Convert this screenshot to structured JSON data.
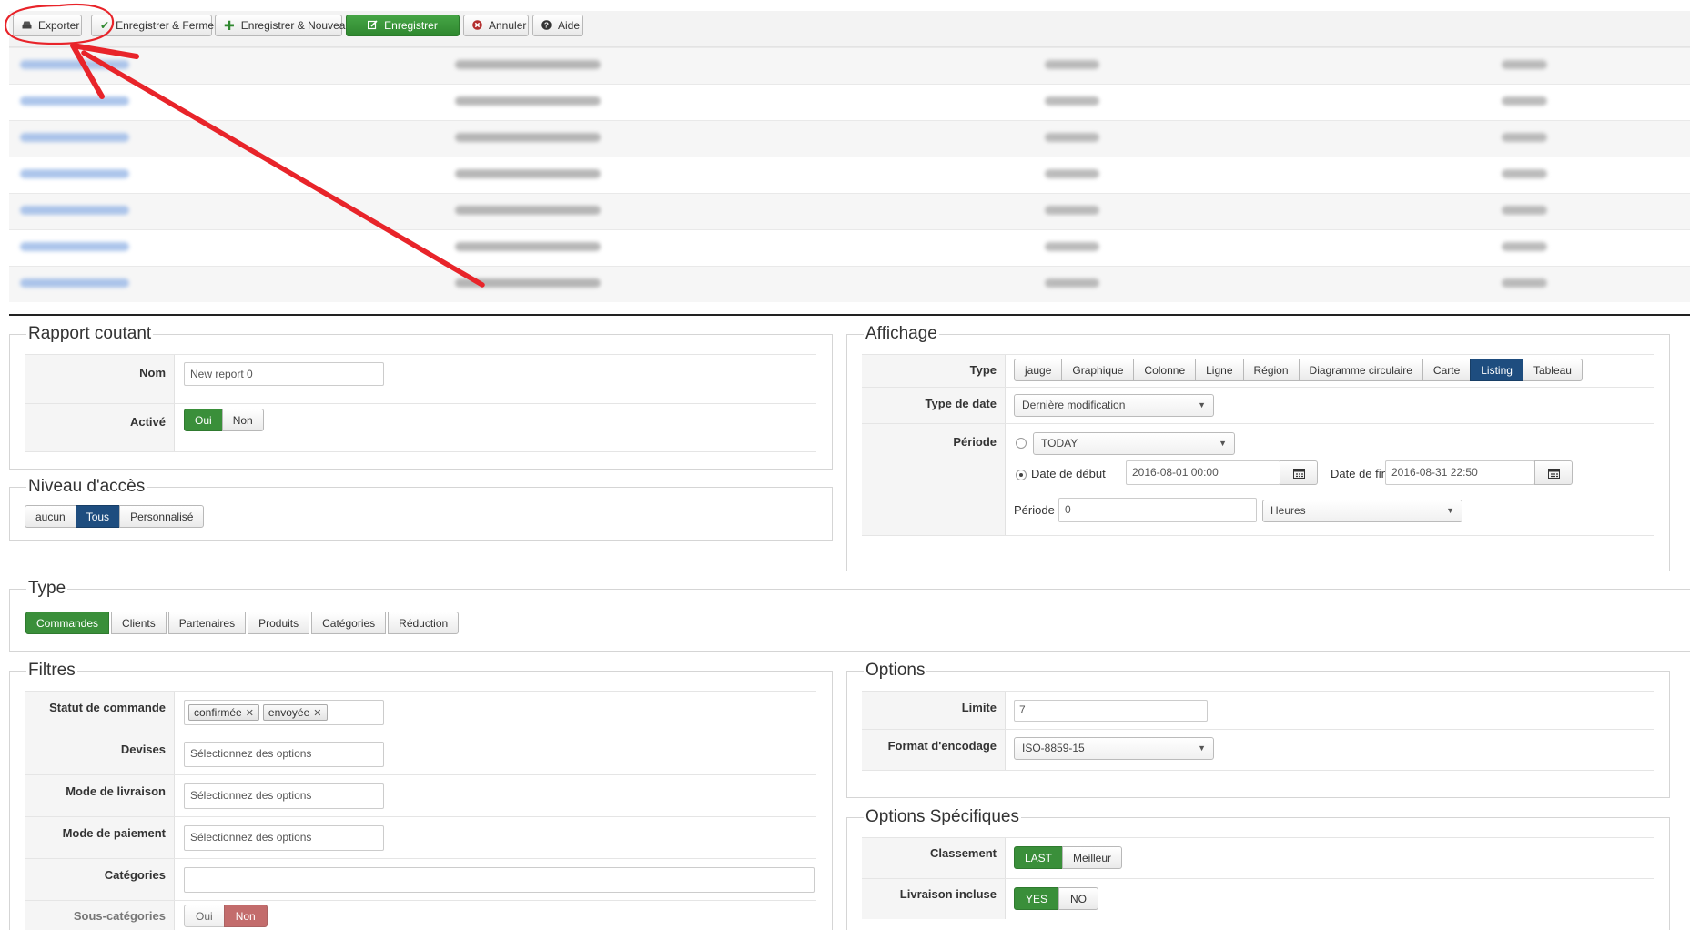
{
  "toolbar": {
    "export": "Exporter",
    "save_close": "Enregistrer & Fermer",
    "save_new": "Enregistrer & Nouveau",
    "save": "Enregistrer",
    "cancel": "Annuler",
    "help": "Aide"
  },
  "rapport": {
    "legend": "Rapport coutant",
    "nom_label": "Nom",
    "nom_value": "New report 0",
    "active_label": "Activé",
    "oui": "Oui",
    "non": "Non"
  },
  "acces": {
    "legend": "Niveau d'accès",
    "options": [
      "aucun",
      "Tous",
      "Personnalisé"
    ]
  },
  "affichage": {
    "legend": "Affichage",
    "type_label": "Type",
    "types": [
      "jauge",
      "Graphique",
      "Colonne",
      "Ligne",
      "Région",
      "Diagramme circulaire",
      "Carte",
      "Listing",
      "Tableau"
    ],
    "type_date_label": "Type de date",
    "type_date_value": "Dernière modification",
    "periode_label": "Période",
    "periode_select": "TODAY",
    "date_debut_label": "Date de début",
    "date_debut_value": "2016-08-01 00:00",
    "date_fin_label": "Date de fin",
    "date_fin_value": "2016-08-31 22:50",
    "periode2_label": "Période",
    "periode2_value": "0",
    "unit_value": "Heures"
  },
  "type": {
    "legend": "Type",
    "options": [
      "Commandes",
      "Clients",
      "Partenaires",
      "Produits",
      "Catégories",
      "Réduction"
    ]
  },
  "filtres": {
    "legend": "Filtres",
    "statut_label": "Statut de commande",
    "statut_chips": [
      "confirmée",
      "envoyée"
    ],
    "devises_label": "Devises",
    "livraison_label": "Mode de livraison",
    "paiement_label": "Mode de paiement",
    "placeholder": "Sélectionnez des options",
    "categories_label": "Catégories",
    "sous_categories_label": "Sous-catégories",
    "oui": "Oui",
    "non": "Non"
  },
  "options": {
    "legend": "Options",
    "limite_label": "Limite",
    "limite_value": "7",
    "encodage_label": "Format d'encodage",
    "encodage_value": "ISO-8859-15"
  },
  "specifiques": {
    "legend": "Options Spécifiques",
    "classement_label": "Classement",
    "last": "LAST",
    "meilleur": "Meilleur",
    "livraison_label": "Livraison incluse",
    "yes": "YES",
    "no": "NO"
  },
  "colors": {
    "green": "#3a8f3a",
    "blue": "#1e4d7f",
    "red": "#b03b3b",
    "annotation": "#e8242a"
  }
}
